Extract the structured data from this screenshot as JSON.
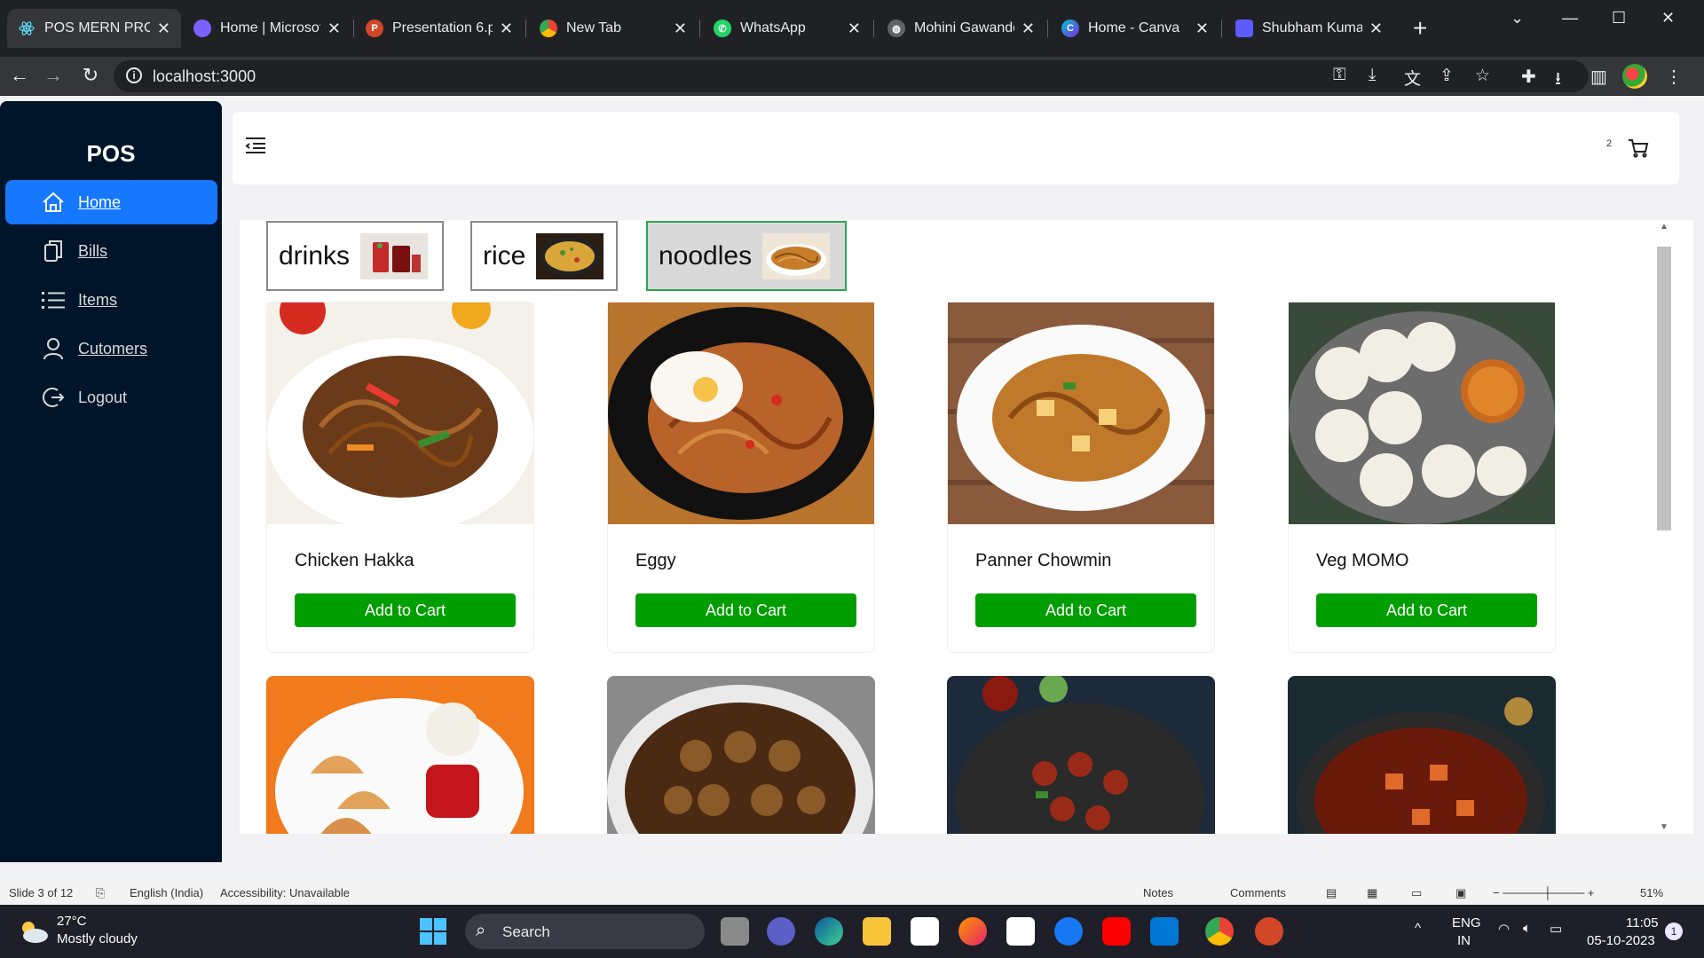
{
  "browser": {
    "tabs": [
      {
        "title": "POS MERN PROJ",
        "icon": "react-icon",
        "color": "#61dafb"
      },
      {
        "title": "Home | Microsof",
        "icon": "copilot-icon",
        "color": "#7b61ff"
      },
      {
        "title": "Presentation 6.p",
        "icon": "powerpoint-icon",
        "color": "#d24726"
      },
      {
        "title": "New Tab",
        "icon": "chrome-icon",
        "color": "#dadce0"
      },
      {
        "title": "WhatsApp",
        "icon": "whatsapp-icon",
        "color": "#25d366"
      },
      {
        "title": "Mohini Gawande",
        "icon": "globe-icon",
        "color": "#9aa0a6"
      },
      {
        "title": "Home - Canva",
        "icon": "canva-icon",
        "color": "#00c4cc"
      },
      {
        "title": "Shubham Kumar",
        "icon": "shield-icon",
        "color": "#5b5bff"
      }
    ],
    "url": "localhost:3000"
  },
  "sidebar": {
    "logo": "POS",
    "items": [
      {
        "label": "Home",
        "icon": "home-icon",
        "active": true
      },
      {
        "label": "Bills",
        "icon": "copy-icon"
      },
      {
        "label": "Items",
        "icon": "list-icon"
      },
      {
        "label": "Cutomers",
        "icon": "user-icon"
      },
      {
        "label": "Logout",
        "icon": "logout-icon"
      }
    ]
  },
  "header": {
    "cart_count": "2"
  },
  "categories": [
    {
      "name": "drinks",
      "selected": false
    },
    {
      "name": "rice",
      "selected": false
    },
    {
      "name": "noodles",
      "selected": true
    }
  ],
  "items": [
    {
      "name": "Chicken Hakka",
      "button": "Add to Cart"
    },
    {
      "name": "Eggy",
      "button": "Add to Cart"
    },
    {
      "name": "Panner Chowmin",
      "button": "Add to Cart"
    },
    {
      "name": "Veg MOMO",
      "button": "Add to Cart"
    }
  ],
  "ppt_status": {
    "slide": "Slide 3 of 12",
    "language": "English (India)",
    "accessibility": "Accessibility: Unavailable",
    "notes": "Notes",
    "comments": "Comments",
    "zoom": "51%"
  },
  "taskbar": {
    "temperature": "27°C",
    "weather": "Mostly cloudy",
    "search": "Search",
    "lang1": "ENG",
    "lang2": "IN",
    "time": "11:05",
    "date": "05-10-2023",
    "notifications": "1"
  }
}
